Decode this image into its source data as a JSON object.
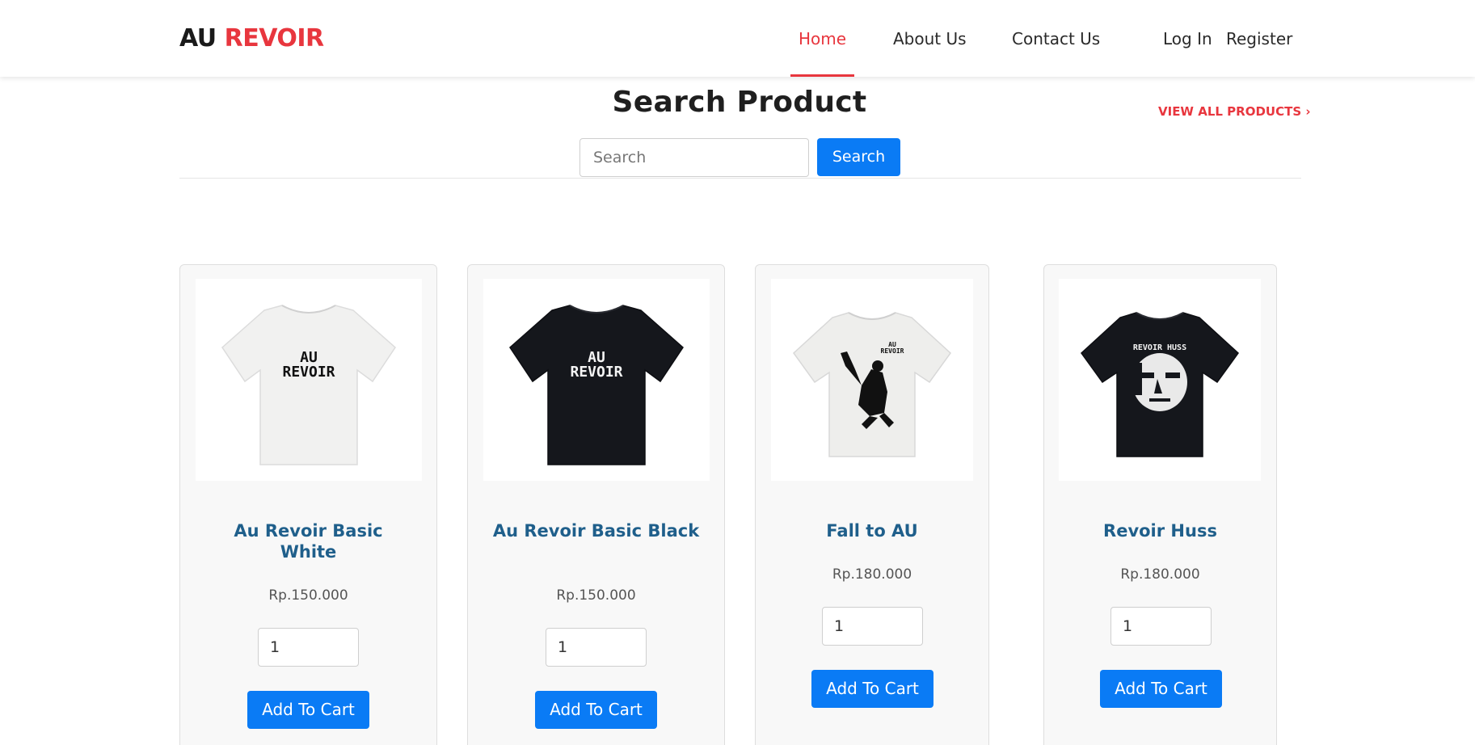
{
  "brand": {
    "part1": "AU",
    "part2": "REVOIR"
  },
  "nav": {
    "home": "Home",
    "about": "About Us",
    "contact": "Contact Us",
    "login": "Log In",
    "register": "Register"
  },
  "search": {
    "title": "Search Product",
    "placeholder": "Search",
    "button": "Search",
    "view_all": "VIEW ALL PRODUCTS ›"
  },
  "products": [
    {
      "name": "Au Revoir Basic White",
      "price": "Rp.150.000",
      "qty": "1",
      "button": "Add To Cart",
      "print": "AU REVOIR"
    },
    {
      "name": "Au Revoir Basic Black",
      "price": "Rp.150.000",
      "qty": "1",
      "button": "Add To Cart",
      "print": "AU REVOIR"
    },
    {
      "name": "Fall to AU",
      "price": "Rp.180.000",
      "qty": "1",
      "button": "Add To Cart",
      "print": "AU"
    },
    {
      "name": "Revoir Huss",
      "price": "Rp.180.000",
      "qty": "1",
      "button": "Add To Cart",
      "print": "REVOIR HUSS"
    }
  ],
  "colors": {
    "accent": "#e8363e",
    "primary": "#0a7bf5",
    "product_title": "#1f5f8b"
  }
}
